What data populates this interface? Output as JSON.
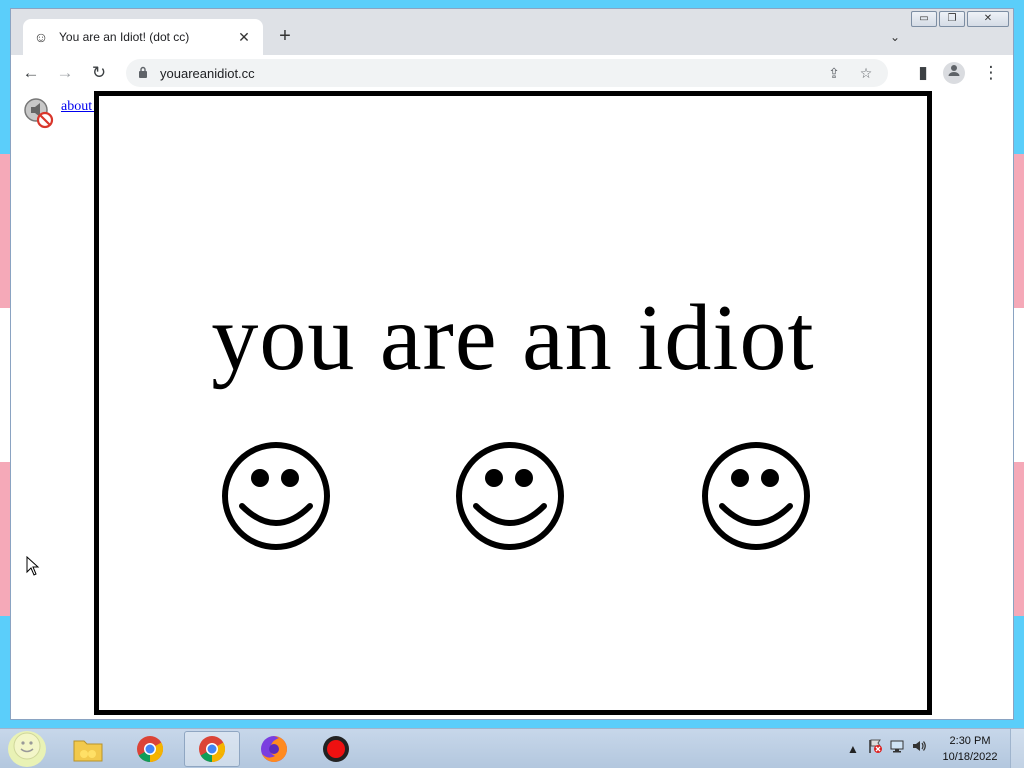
{
  "browser": {
    "tab": {
      "title": "You are an Idiot! (dot cc)",
      "favicon_icon": "smiley-icon",
      "close_glyph": "✕"
    },
    "new_tab_glyph": "+",
    "tab_search_glyph": "⌄",
    "window_controls": {
      "minimize": "▭",
      "restore": "❐",
      "close": "✕"
    },
    "nav": {
      "back": "←",
      "forward": "→",
      "reload": "↻"
    },
    "url": "youareanidiot.cc",
    "lock_glyph": "🔒",
    "share_glyph": "⇪",
    "bookmark_glyph": "☆",
    "sidepanel_glyph": "▮",
    "profile_glyph": "●",
    "menu_glyph": "⋮"
  },
  "page": {
    "flash_link": "about flash",
    "headline": "you are an idiot",
    "border_color": "#000000"
  },
  "taskbar": {
    "clock_time": "2:30 PM",
    "clock_date": "10/18/2022",
    "apps": [
      "folder-icon",
      "chrome-icon",
      "chrome-icon",
      "firefox-icon",
      "record-icon"
    ],
    "tray_glyphs": {
      "arrow": "▲",
      "flag": "⚑",
      "network": "▣",
      "volume": "🔊"
    }
  },
  "wallpaper_colors": {
    "blue": "#5bcefa",
    "pink": "#f5a9b8",
    "white": "#ffffff"
  }
}
